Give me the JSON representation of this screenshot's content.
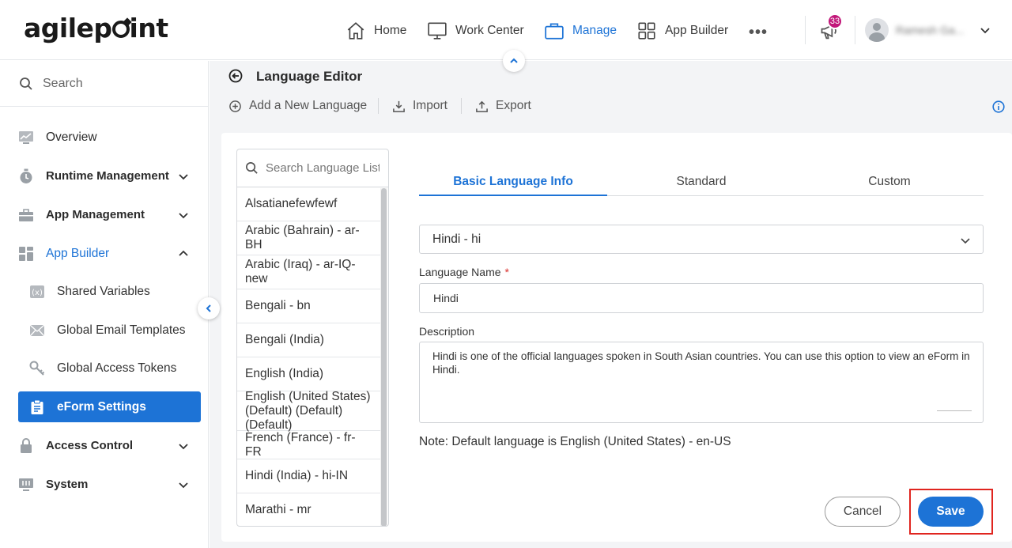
{
  "brand": {
    "logo_text": "agilepoint"
  },
  "topnav": {
    "items": [
      {
        "label": "Home",
        "icon": "home-icon"
      },
      {
        "label": "Work Center",
        "icon": "monitor-icon"
      },
      {
        "label": "Manage",
        "icon": "briefcase-icon",
        "active": true
      },
      {
        "label": "App Builder",
        "icon": "grid-icon"
      }
    ],
    "more_label": "•••",
    "notification_count": "33",
    "user_name": "Ramesh Ga..."
  },
  "sidebar": {
    "search_label": "Search",
    "items": [
      {
        "label": "Overview",
        "icon": "chart-icon"
      },
      {
        "label": "Runtime Management",
        "icon": "stopwatch-icon"
      },
      {
        "label": "App Management",
        "icon": "toolbox-icon"
      },
      {
        "label": "App Builder",
        "icon": "app-builder-icon"
      },
      {
        "label": "Shared Variables",
        "icon": "variable-icon"
      },
      {
        "label": "Global Email Templates",
        "icon": "mail-icon"
      },
      {
        "label": "Global Access Tokens",
        "icon": "key-icon"
      },
      {
        "label": "eForm Settings",
        "icon": "clipboard-icon"
      },
      {
        "label": "Access Control",
        "icon": "lock-icon"
      },
      {
        "label": "System",
        "icon": "system-icon"
      }
    ]
  },
  "editor": {
    "title": "Language Editor",
    "toolbar": {
      "add_label": "Add a New Language",
      "import_label": "Import",
      "export_label": "Export"
    }
  },
  "language_list": {
    "search_placeholder": "Search Language List",
    "items": [
      "Alsatianefewfewf",
      "Arabic (Bahrain) - ar-BH",
      "Arabic (Iraq) - ar-IQ-new",
      "Bengali - bn",
      "Bengali (India)",
      "English (India)",
      "English (United States) (Default) (Default) (Default)",
      "French (France) - fr-FR",
      "Hindi (India) - hi-IN",
      "Marathi - mr"
    ]
  },
  "tabs": [
    "Basic Language Info",
    "Standard",
    "Custom"
  ],
  "form": {
    "selected_language": "Hindi - hi",
    "name_label": "Language Name",
    "required_marker": "*",
    "name_value": "Hindi",
    "description_label": "Description",
    "description_value": "Hindi is one of the official languages spoken in South Asian countries. You can use this option to view an eForm in Hindi.",
    "note": "Note: Default language is English (United States) - en-US"
  },
  "actions": {
    "cancel_label": "Cancel",
    "save_label": "Save"
  },
  "colors": {
    "accent": "#1d73d6",
    "highlight": "#e0251f",
    "badge": "#c2187a"
  }
}
